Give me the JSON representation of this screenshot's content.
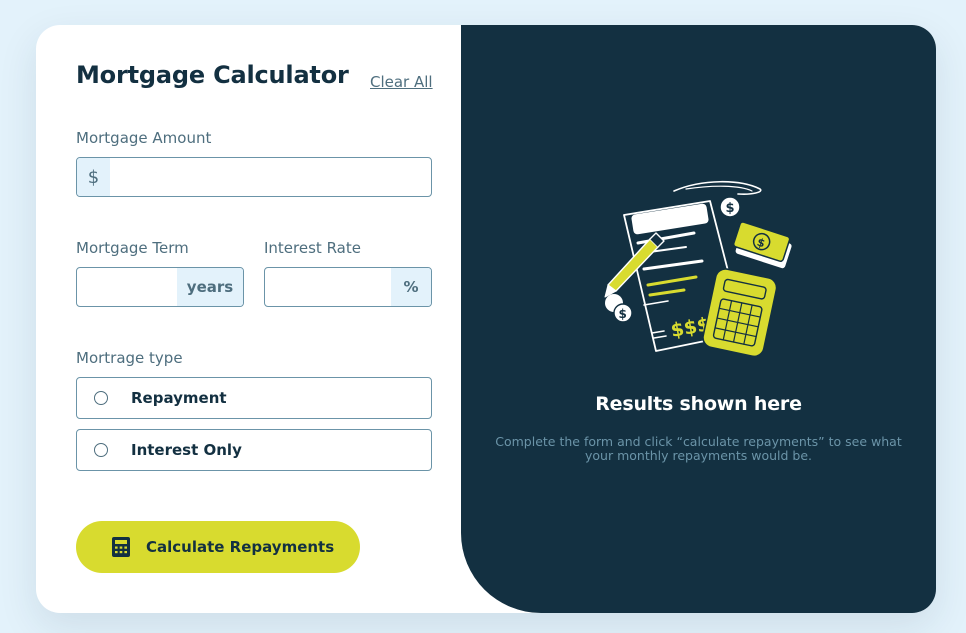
{
  "form": {
    "title": "Mortgage Calculator",
    "clear_all": "Clear All",
    "amount": {
      "label": "Mortgage Amount",
      "prefix": "$",
      "value": ""
    },
    "term": {
      "label": "Mortgage Term",
      "suffix": "years",
      "value": ""
    },
    "rate": {
      "label": "Interest Rate",
      "suffix": "%",
      "value": ""
    },
    "type": {
      "label": "Mortrage type",
      "options": [
        {
          "label": "Repayment",
          "selected": false
        },
        {
          "label": "Interest Only",
          "selected": false
        }
      ]
    },
    "submit_label": "Calculate Repayments"
  },
  "results": {
    "title": "Results shown here",
    "description": "Complete the form and click “calculate repayments” to see what your monthly repayments would be."
  },
  "colors": {
    "lime": "#d8db2f",
    "dark_slate": "#133041",
    "slate": "#4e6e7e",
    "light_blue": "#e3f2fb",
    "border": "#6b94a8"
  },
  "icons": {
    "submit": "calculator-icon",
    "illustration": "empty-results-illustration"
  }
}
